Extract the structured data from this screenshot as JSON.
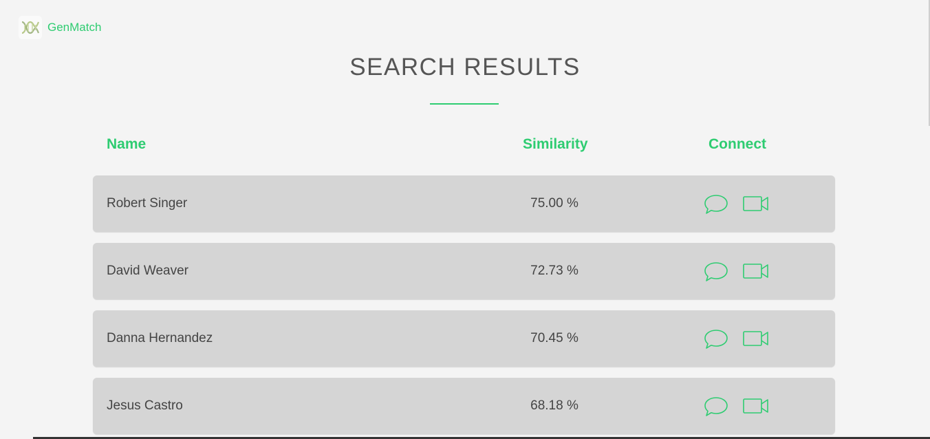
{
  "brand": {
    "name": "GenMatch",
    "logo_icon": "dna-icon"
  },
  "page": {
    "title": "SEARCH RESULTS"
  },
  "columns": {
    "name": "Name",
    "similarity": "Similarity",
    "connect": "Connect"
  },
  "results": [
    {
      "name": "Robert Singer",
      "similarity": "75.00 %"
    },
    {
      "name": "David Weaver",
      "similarity": "72.73 %"
    },
    {
      "name": "Danna Hernandez",
      "similarity": "70.45 %"
    },
    {
      "name": "Jesus Castro",
      "similarity": "68.18 %"
    }
  ],
  "colors": {
    "accent": "#2ecc71",
    "row_bg": "#d5d5d5",
    "page_bg": "#f4f4f4",
    "text": "#444444"
  }
}
